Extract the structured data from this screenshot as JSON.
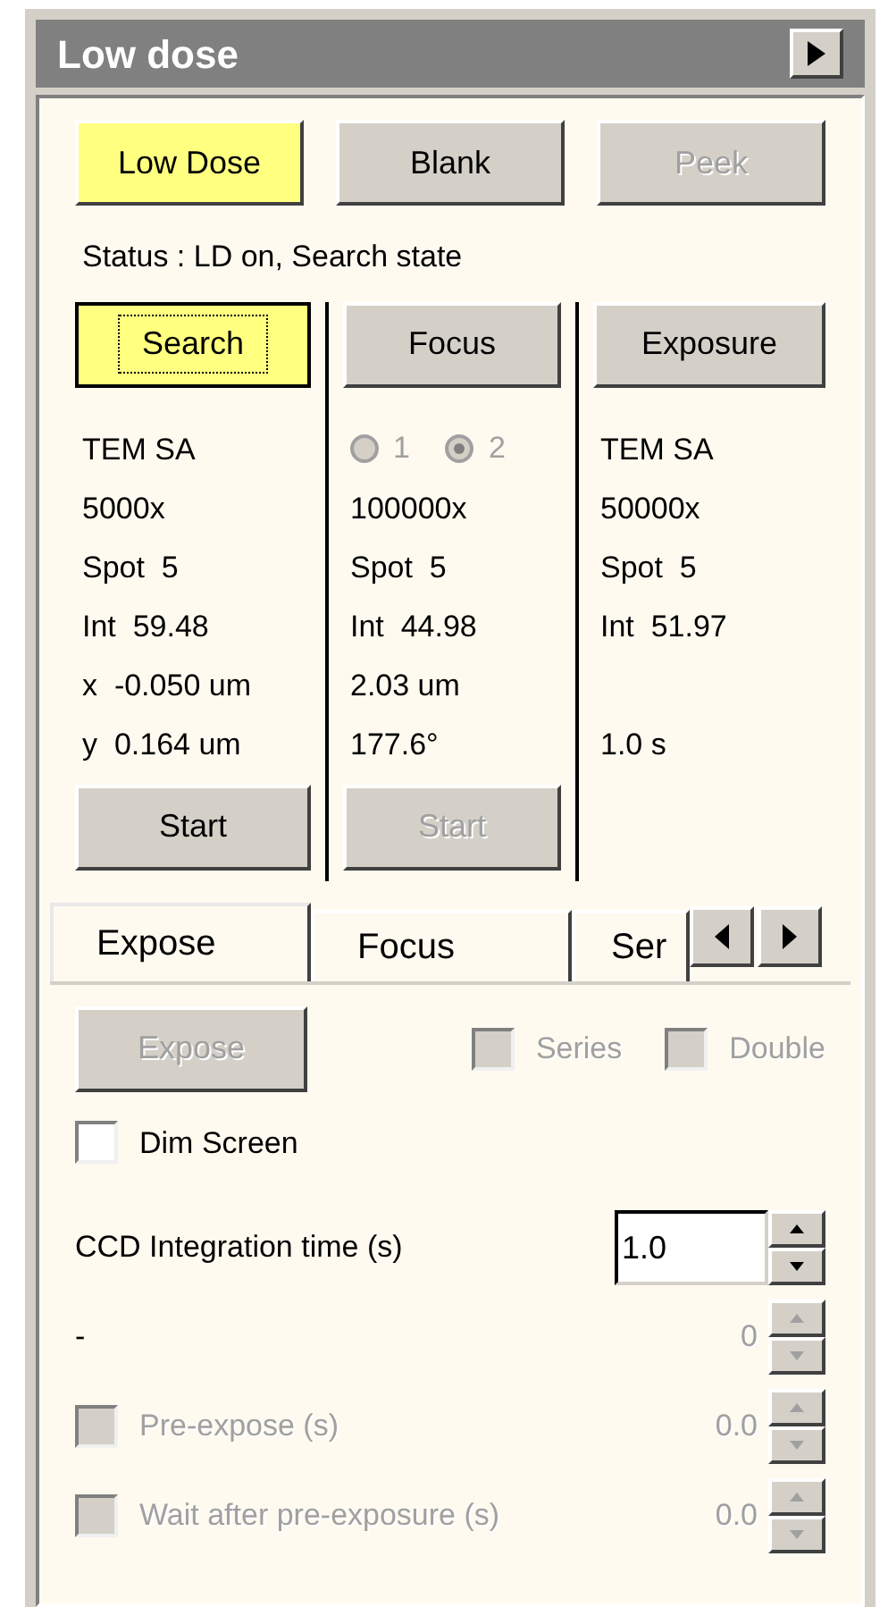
{
  "window": {
    "title": "Low dose"
  },
  "top_buttons": [
    {
      "label": "Low Dose",
      "active": true,
      "disabled": false
    },
    {
      "label": "Blank",
      "active": false,
      "disabled": false
    },
    {
      "label": "Peek",
      "active": false,
      "disabled": true
    }
  ],
  "status": "Status : LD on, Search state",
  "columns": [
    {
      "button": {
        "label": "Search",
        "active": true,
        "focused": true
      },
      "lines": [
        {
          "text": "TEM SA"
        },
        {
          "text": "5000x"
        },
        {
          "text": "Spot  5"
        },
        {
          "text": "Int  59.48"
        },
        {
          "text": "x  -0.050 um"
        },
        {
          "text": "y  0.164 um"
        }
      ],
      "start": {
        "label": "Start",
        "disabled": false
      }
    },
    {
      "button": {
        "label": "Focus",
        "active": false,
        "focused": false
      },
      "radios": {
        "disabled": true,
        "options": [
          {
            "label": "1",
            "selected": false
          },
          {
            "label": "2",
            "selected": true
          }
        ]
      },
      "lines": [
        {
          "text": "100000x"
        },
        {
          "text": "Spot  5"
        },
        {
          "text": "Int  44.98"
        },
        {
          "text": "2.03 um"
        },
        {
          "text": "177.6°"
        }
      ],
      "start": {
        "label": "Start",
        "disabled": true
      }
    },
    {
      "button": {
        "label": "Exposure",
        "active": false,
        "focused": false
      },
      "lines": [
        {
          "text": "TEM SA"
        },
        {
          "text": "50000x"
        },
        {
          "text": "Spot  5"
        },
        {
          "text": "Int  51.97"
        },
        {
          "text": "1.0 s",
          "gap_before": true
        }
      ]
    }
  ],
  "tabs": [
    {
      "label": "Expose",
      "selected": true
    },
    {
      "label": "Focus",
      "selected": false
    },
    {
      "label": "Ser",
      "selected": false
    }
  ],
  "expose_button": {
    "label": "Expose",
    "disabled": true
  },
  "options": [
    {
      "label": "Series",
      "checked": false,
      "disabled": true
    },
    {
      "label": "Double",
      "checked": false,
      "disabled": true
    }
  ],
  "dim_screen": {
    "label": "Dim Screen",
    "checked": false,
    "disabled": false
  },
  "settings": [
    {
      "kind": "input",
      "label": "CCD Integration time (s)",
      "value": "1.0",
      "disabled": false
    },
    {
      "kind": "readout",
      "label": "-",
      "value": "0",
      "disabled": true
    },
    {
      "kind": "check",
      "label": "Pre-expose (s)",
      "value": "0.0",
      "checked": false,
      "disabled": true
    },
    {
      "kind": "check",
      "label": "Wait after pre-exposure (s)",
      "value": "0.0",
      "checked": false,
      "disabled": true
    }
  ]
}
